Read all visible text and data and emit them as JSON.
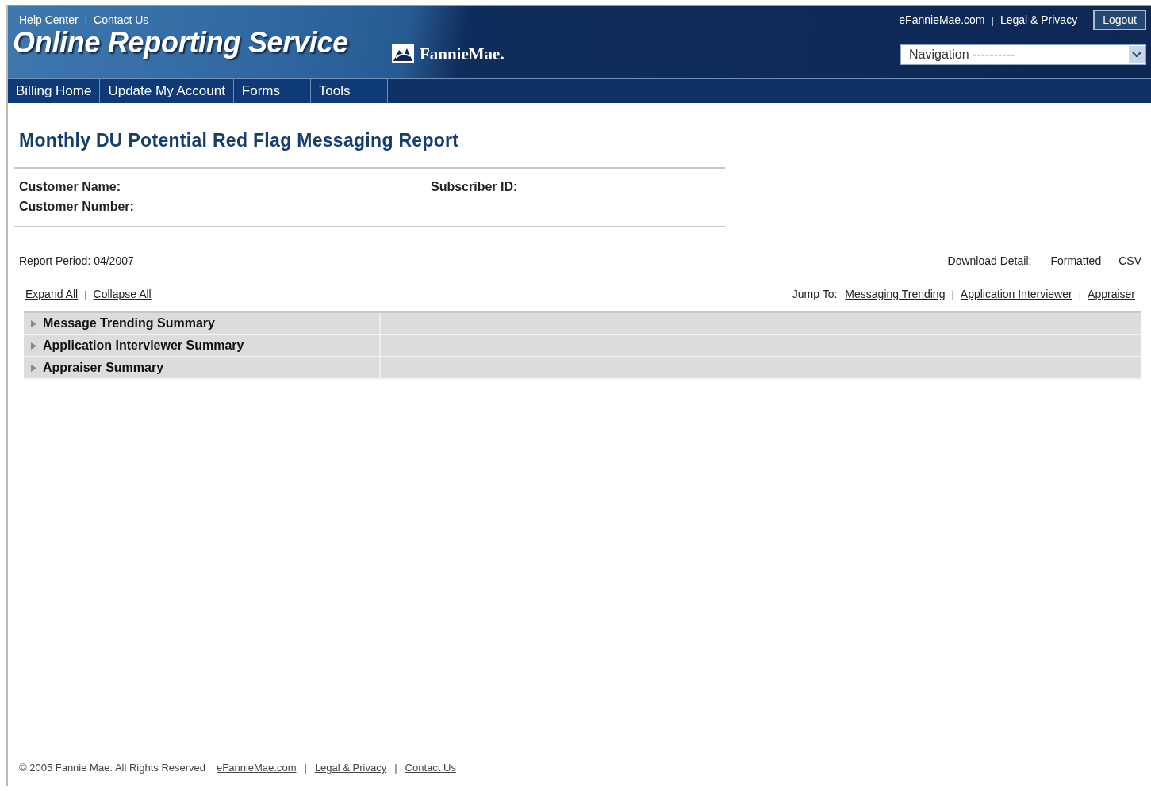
{
  "header": {
    "top_links": [
      "Help Center",
      "Contact Us"
    ],
    "separator": "|",
    "title": "Online Reporting Service",
    "logo": "FannieMae.",
    "right_links": [
      "eFannieMae.com",
      "Legal & Privacy"
    ],
    "logout": "Logout",
    "navigation": {
      "value": "Navigation ----------"
    }
  },
  "tabs": [
    {
      "label": "Billing Home"
    },
    {
      "label": "Update My Account"
    },
    {
      "label": "Forms"
    },
    {
      "label": "Tools"
    }
  ],
  "report": {
    "title": "Monthly DU Potential Red Flag Messaging Report",
    "fields": [
      {
        "label": "Customer Name:"
      },
      {
        "label": "Subscriber ID:"
      },
      {
        "label": "Customer Number:"
      }
    ],
    "period": "Report Period: 04/2007",
    "download": {
      "label": "Download Detail:",
      "links": [
        "Formatted",
        "CSV"
      ]
    },
    "toggle_links": [
      "Expand All",
      "Collapse All"
    ],
    "jump": {
      "label": "Jump To:",
      "links": [
        "Messaging Trending",
        "Application Interviewer",
        "Appraiser"
      ]
    },
    "sections": [
      {
        "title": "Message Trending Summary",
        "expanded": false
      },
      {
        "title": "Application Interviewer Summary",
        "expanded": false
      },
      {
        "title": "Appraiser Summary",
        "expanded": false
      }
    ]
  },
  "footer": {
    "copyright": "© 2005 Fannie Mae. All Rights Reserved",
    "links": [
      "eFannieMae.com",
      "Legal & Privacy",
      "Contact Us"
    ]
  }
}
